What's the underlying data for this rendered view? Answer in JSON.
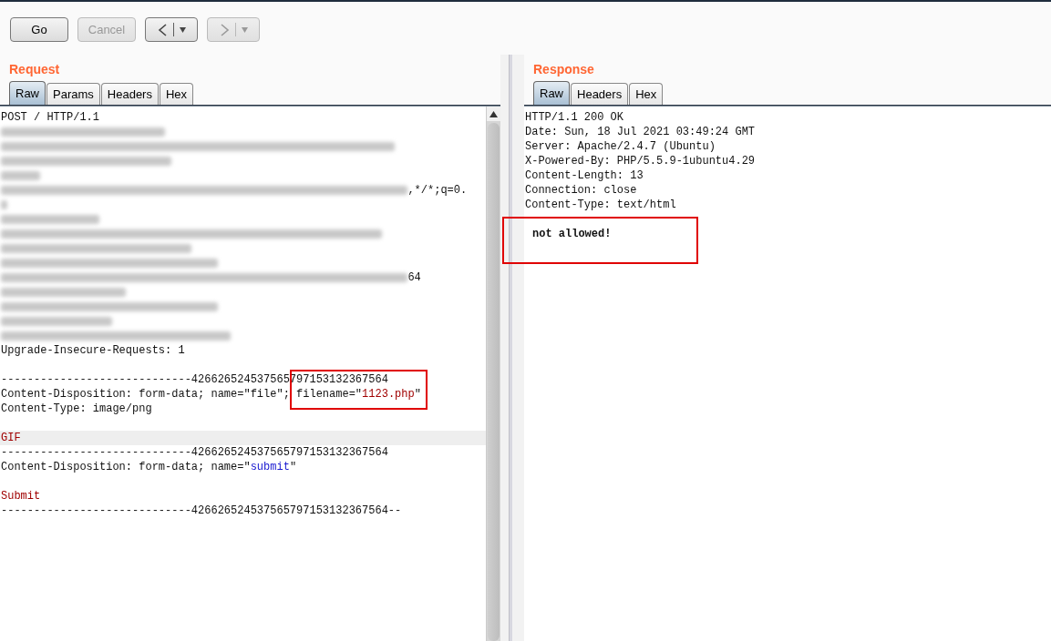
{
  "toolbar": {
    "buttons": [
      {
        "kind": "text",
        "label": "Go",
        "disabled": false
      },
      {
        "kind": "text",
        "label": "Cancel",
        "disabled": true
      },
      {
        "kind": "back",
        "disabled": false
      },
      {
        "kind": "forward",
        "disabled": true
      }
    ]
  },
  "request": {
    "title": "Request",
    "has_scrollbar": true,
    "tabs": [
      {
        "label": "Raw",
        "selected": true
      },
      {
        "label": "Params",
        "selected": false
      },
      {
        "label": "Headers",
        "selected": false
      },
      {
        "label": "Hex",
        "selected": false
      }
    ],
    "lines": [
      {
        "highlighted": false,
        "segments": [
          {
            "kind": "plain",
            "text": "POST / HTTP/1.1"
          }
        ]
      },
      {
        "highlighted": false,
        "segments": [
          {
            "kind": "redacted"
          }
        ]
      },
      {
        "highlighted": false,
        "segments": [
          {
            "kind": "redacted"
          }
        ]
      },
      {
        "highlighted": false,
        "segments": [
          {
            "kind": "redacted"
          }
        ]
      },
      {
        "highlighted": false,
        "segments": [
          {
            "kind": "redacted"
          }
        ]
      },
      {
        "highlighted": false,
        "segments": [
          {
            "kind": "redacted"
          },
          {
            "kind": "plain",
            "text": ",*/*;q=0."
          }
        ]
      },
      {
        "highlighted": false,
        "segments": [
          {
            "kind": "redacted"
          }
        ]
      },
      {
        "highlighted": false,
        "segments": [
          {
            "kind": "redacted"
          }
        ]
      },
      {
        "highlighted": false,
        "segments": [
          {
            "kind": "redacted"
          }
        ]
      },
      {
        "highlighted": false,
        "segments": [
          {
            "kind": "redacted"
          }
        ]
      },
      {
        "highlighted": false,
        "segments": [
          {
            "kind": "redacted"
          }
        ]
      },
      {
        "highlighted": false,
        "segments": [
          {
            "kind": "redacted"
          },
          {
            "kind": "plain",
            "text": "64"
          }
        ]
      },
      {
        "highlighted": false,
        "segments": [
          {
            "kind": "redacted"
          }
        ]
      },
      {
        "highlighted": false,
        "segments": [
          {
            "kind": "redacted"
          }
        ]
      },
      {
        "highlighted": false,
        "segments": [
          {
            "kind": "redacted"
          }
        ]
      },
      {
        "highlighted": false,
        "segments": [
          {
            "kind": "redacted"
          }
        ]
      },
      {
        "highlighted": false,
        "segments": [
          {
            "kind": "plain",
            "text": "Upgrade-Insecure-Requests: 1"
          }
        ]
      },
      {
        "highlighted": false
      },
      {
        "highlighted": false,
        "segments": [
          {
            "kind": "plain",
            "text": "-----------------------------426626524537565797153132367564"
          }
        ]
      },
      {
        "highlighted": false,
        "segments": [
          {
            "kind": "plain",
            "text": "Content-Disposition: form-data; name=\"file\"; filename=\""
          },
          {
            "kind": "value",
            "text": "1123.php"
          },
          {
            "kind": "plain",
            "text": "\""
          }
        ]
      },
      {
        "highlighted": false,
        "segments": [
          {
            "kind": "plain",
            "text": "Content-Type: image/png"
          }
        ]
      },
      {
        "highlighted": false
      },
      {
        "highlighted": true,
        "segments": [
          {
            "kind": "value",
            "text": "GIF"
          }
        ]
      },
      {
        "highlighted": false,
        "segments": [
          {
            "kind": "plain",
            "text": "-----------------------------426626524537565797153132367564"
          }
        ]
      },
      {
        "highlighted": false,
        "segments": [
          {
            "kind": "plain",
            "text": "Content-Disposition: form-data; name=\""
          },
          {
            "kind": "keyword",
            "text": "submit"
          },
          {
            "kind": "plain",
            "text": "\""
          }
        ]
      },
      {
        "highlighted": false
      },
      {
        "highlighted": false,
        "segments": [
          {
            "kind": "value",
            "text": "Submit"
          }
        ]
      },
      {
        "highlighted": false,
        "segments": [
          {
            "kind": "plain",
            "text": "-----------------------------426626524537565797153132367564--"
          }
        ]
      }
    ]
  },
  "response": {
    "title": "Response",
    "has_scrollbar": false,
    "tabs": [
      {
        "label": "Raw",
        "selected": true
      },
      {
        "label": "Headers",
        "selected": false
      },
      {
        "label": "Hex",
        "selected": false
      }
    ],
    "lines": [
      {
        "highlighted": false,
        "segments": [
          {
            "kind": "plain",
            "text": "HTTP/1.1 200 OK"
          }
        ]
      },
      {
        "highlighted": false,
        "segments": [
          {
            "kind": "plain",
            "text": "Date: Sun, 18 Jul 2021 03:49:24 GMT"
          }
        ]
      },
      {
        "highlighted": false,
        "segments": [
          {
            "kind": "plain",
            "text": "Server: Apache/2.4.7 (Ubuntu)"
          }
        ]
      },
      {
        "highlighted": false,
        "segments": [
          {
            "kind": "plain",
            "text": "X-Powered-By: PHP/5.5.9-1ubuntu4.29"
          }
        ]
      },
      {
        "highlighted": false,
        "segments": [
          {
            "kind": "plain",
            "text": "Content-Length: 13"
          }
        ]
      },
      {
        "highlighted": false,
        "segments": [
          {
            "kind": "plain",
            "text": "Connection: close"
          }
        ]
      },
      {
        "highlighted": false,
        "segments": [
          {
            "kind": "plain",
            "text": "Content-Type: text/html"
          }
        ]
      },
      {
        "highlighted": false
      },
      {
        "highlighted": false,
        "segments": [
          {
            "kind": "body",
            "text": "not allowed!"
          }
        ]
      }
    ]
  },
  "markup_boxes": [
    {
      "kind": "outline"
    },
    {
      "kind": "outline"
    }
  ]
}
